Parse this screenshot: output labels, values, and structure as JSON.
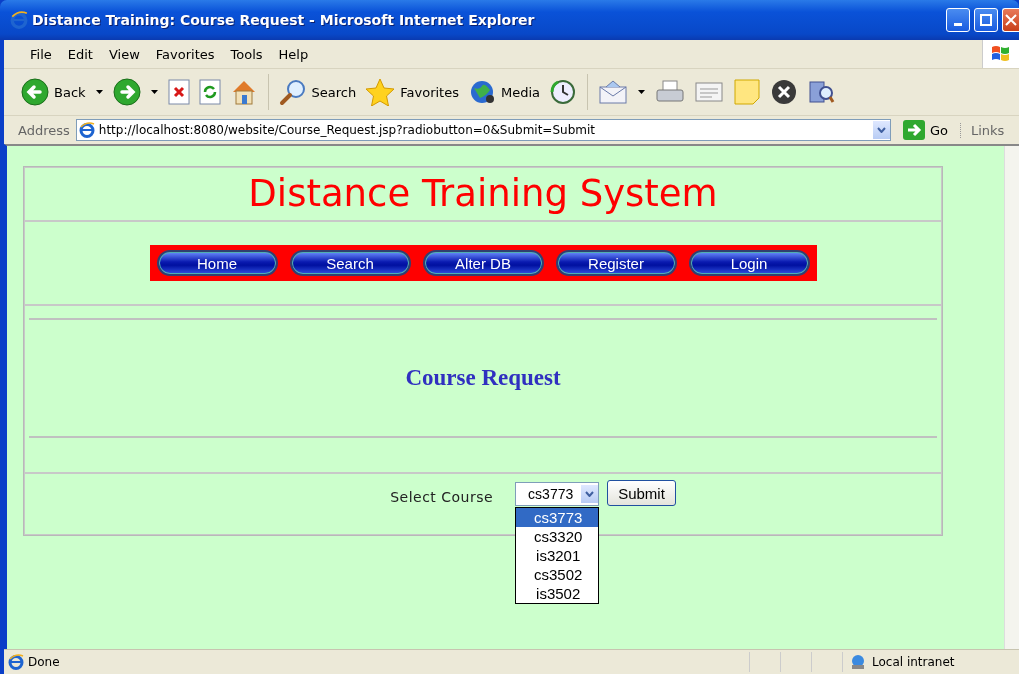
{
  "window": {
    "title": "Distance Training: Course Request - Microsoft Internet Explorer"
  },
  "menu_bar": [
    {
      "label": "File"
    },
    {
      "label": "Edit"
    },
    {
      "label": "View"
    },
    {
      "label": "Favorites"
    },
    {
      "label": "Tools"
    },
    {
      "label": "Help"
    }
  ],
  "toolbar": [
    {
      "kind": "back",
      "label": "Back"
    },
    {
      "kind": "caret"
    },
    {
      "kind": "forward"
    },
    {
      "kind": "caret"
    },
    {
      "kind": "stop"
    },
    {
      "kind": "refresh"
    },
    {
      "kind": "home"
    },
    {
      "kind": "separator"
    },
    {
      "kind": "search",
      "label": "Search"
    },
    {
      "kind": "favorites",
      "label": "Favorites"
    },
    {
      "kind": "media",
      "label": "Media"
    },
    {
      "kind": "history"
    },
    {
      "kind": "separator"
    },
    {
      "kind": "mail"
    },
    {
      "kind": "caret"
    },
    {
      "kind": "print"
    },
    {
      "kind": "edit"
    },
    {
      "kind": "note"
    },
    {
      "kind": "messenger"
    },
    {
      "kind": "research"
    }
  ],
  "address_bar": {
    "label": "Address",
    "url": "http://localhost:8080/website/Course_Request.jsp?radiobutton=0&Submit=Submit",
    "go": "Go",
    "links": "Links"
  },
  "page": {
    "heading": "Distance Training System",
    "nav": [
      {
        "label": "Home"
      },
      {
        "label": "Search"
      },
      {
        "label": "Alter DB"
      },
      {
        "label": "Register"
      },
      {
        "label": "Login"
      }
    ],
    "section_title": "Course Request",
    "form": {
      "label": "Select Course",
      "value": "cs3773",
      "submit": "Submit",
      "options": [
        {
          "label": "cs3773",
          "selected": true
        },
        {
          "label": "cs3320",
          "selected": false
        },
        {
          "label": "is3201",
          "selected": false
        },
        {
          "label": "cs3502",
          "selected": false
        },
        {
          "label": "is3502",
          "selected": false
        }
      ]
    }
  },
  "status_bar": {
    "text": "Done",
    "zone": "Local intranet"
  }
}
